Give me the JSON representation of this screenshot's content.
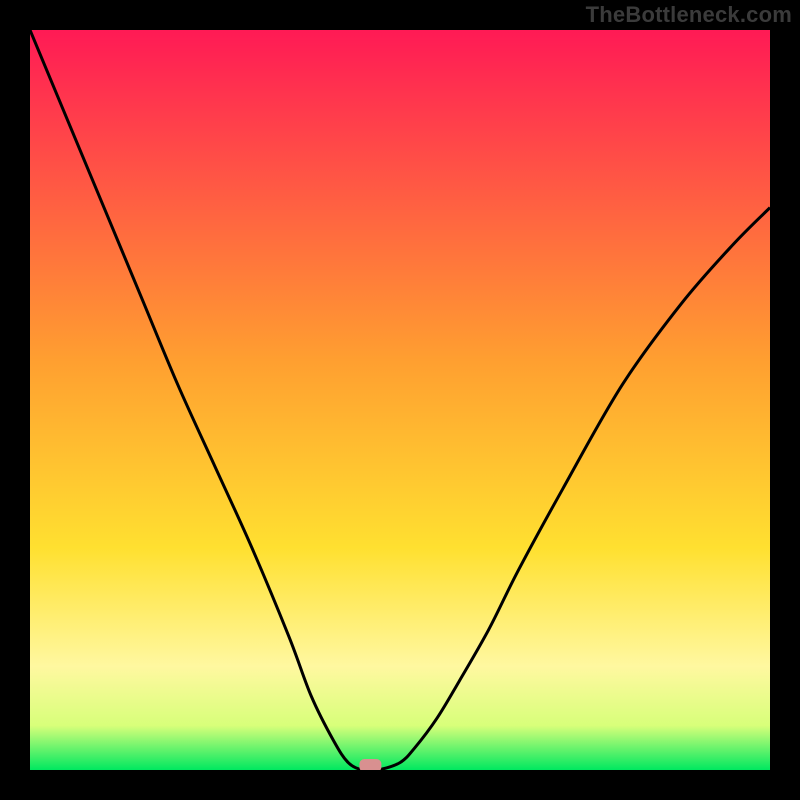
{
  "watermark": "TheBottleneck.com",
  "chart_data": {
    "type": "line",
    "title": "",
    "xlabel": "",
    "ylabel": "",
    "xlim": [
      0,
      100
    ],
    "ylim": [
      0,
      100
    ],
    "grid": false,
    "legend": false,
    "background_gradient": {
      "stops": [
        {
          "pct": 0,
          "color": "#ff1a55"
        },
        {
          "pct": 45,
          "color": "#ffa030"
        },
        {
          "pct": 70,
          "color": "#ffe030"
        },
        {
          "pct": 86,
          "color": "#fff8a0"
        },
        {
          "pct": 94,
          "color": "#d8ff7a"
        },
        {
          "pct": 100,
          "color": "#00e860"
        }
      ]
    },
    "series": [
      {
        "name": "bottleneck-curve",
        "color": "#000000",
        "x": [
          0,
          5,
          10,
          15,
          20,
          25,
          30,
          35,
          38,
          41,
          43,
          45,
          47,
          50,
          52,
          55,
          58,
          62,
          66,
          72,
          80,
          88,
          95,
          100
        ],
        "y": [
          100,
          88,
          76,
          64,
          52,
          41,
          30,
          18,
          10,
          4,
          1,
          0,
          0,
          1,
          3,
          7,
          12,
          19,
          27,
          38,
          52,
          63,
          71,
          76
        ]
      }
    ],
    "marker": {
      "name": "best-match-marker",
      "x": 46,
      "y": 0,
      "color": "#d89090",
      "shape": "rounded-rect"
    }
  }
}
